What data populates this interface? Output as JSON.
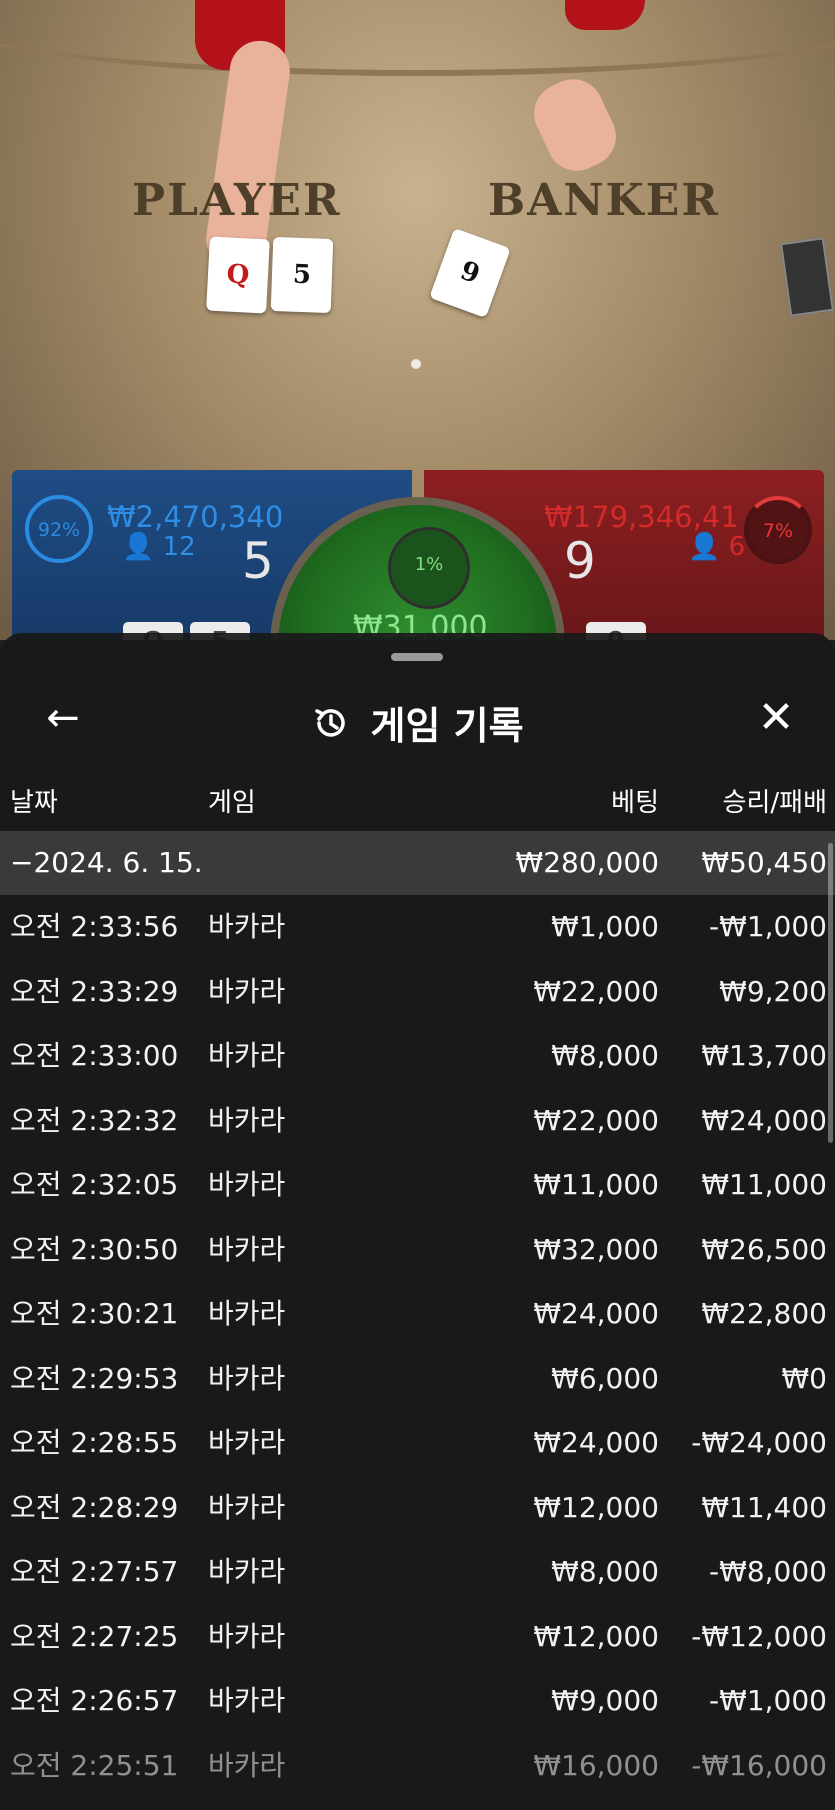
{
  "table": {
    "player_label": "PLAYER",
    "banker_label": "BANKER",
    "player_cards": [
      "Q",
      "5"
    ],
    "banker_cards": [
      "9"
    ]
  },
  "player_panel": {
    "percent": "92%",
    "amount": "₩2,470,340",
    "users": "12",
    "score": "5",
    "color": "#2b8be0"
  },
  "banker_panel": {
    "percent": "7%",
    "amount": "₩179,346,41",
    "users": "6",
    "score": "9",
    "color": "#d32a2a"
  },
  "tie_panel": {
    "percent": "1%",
    "amount": "₩31,000"
  },
  "history": {
    "title": "게임 기록",
    "icons": {
      "back": "arrow-left-icon",
      "title": "history-icon",
      "close": "close-icon"
    },
    "columns": {
      "date": "날짜",
      "game": "게임",
      "bet": "베팅",
      "result": "승리/패배"
    },
    "date_group": {
      "date": "−2024. 6. 15.",
      "bet": "₩280,000",
      "result": "₩50,450"
    },
    "rows": [
      {
        "time": "오전 2:33:56",
        "game": "바카라",
        "bet": "₩1,000",
        "result": "-₩1,000"
      },
      {
        "time": "오전 2:33:29",
        "game": "바카라",
        "bet": "₩22,000",
        "result": "₩9,200"
      },
      {
        "time": "오전 2:33:00",
        "game": "바카라",
        "bet": "₩8,000",
        "result": "₩13,700"
      },
      {
        "time": "오전 2:32:32",
        "game": "바카라",
        "bet": "₩22,000",
        "result": "₩24,000"
      },
      {
        "time": "오전 2:32:05",
        "game": "바카라",
        "bet": "₩11,000",
        "result": "₩11,000"
      },
      {
        "time": "오전 2:30:50",
        "game": "바카라",
        "bet": "₩32,000",
        "result": "₩26,500"
      },
      {
        "time": "오전 2:30:21",
        "game": "바카라",
        "bet": "₩24,000",
        "result": "₩22,800"
      },
      {
        "time": "오전 2:29:53",
        "game": "바카라",
        "bet": "₩6,000",
        "result": "₩0"
      },
      {
        "time": "오전 2:28:55",
        "game": "바카라",
        "bet": "₩24,000",
        "result": "-₩24,000"
      },
      {
        "time": "오전 2:28:29",
        "game": "바카라",
        "bet": "₩12,000",
        "result": "₩11,400"
      },
      {
        "time": "오전 2:27:57",
        "game": "바카라",
        "bet": "₩8,000",
        "result": "-₩8,000"
      },
      {
        "time": "오전 2:27:25",
        "game": "바카라",
        "bet": "₩12,000",
        "result": "-₩12,000"
      },
      {
        "time": "오전 2:26:57",
        "game": "바카라",
        "bet": "₩9,000",
        "result": "-₩1,000"
      },
      {
        "time": "오전 2:25:51",
        "game": "바카라",
        "bet": "₩16,000",
        "result": "-₩16,000"
      }
    ]
  }
}
